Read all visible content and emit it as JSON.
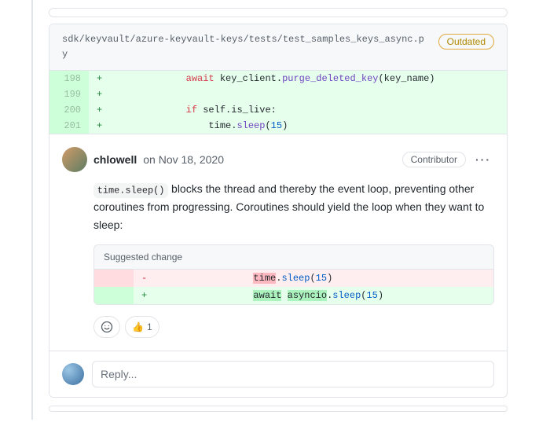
{
  "file": {
    "path": "sdk/keyvault/azure-keyvault-keys/tests/test_samples_keys_async.py",
    "outdated_label": "Outdated"
  },
  "diff": {
    "rows": [
      {
        "lineno": "198",
        "marker": "+",
        "code_html": "            <span class='tok-kw'>await</span> key_client.<span class='tok-call'>purge_deleted_key</span>(key_name)"
      },
      {
        "lineno": "199",
        "marker": "+",
        "code_html": ""
      },
      {
        "lineno": "200",
        "marker": "+",
        "code_html": "            <span class='tok-kw'>if</span> self.is_live:"
      },
      {
        "lineno": "201",
        "marker": "+",
        "code_html": "                time.<span class='tok-call'>sleep</span>(<span class='tok-num'>15</span>)"
      }
    ]
  },
  "comment": {
    "author": "chlowell",
    "timestamp_prefix": "on ",
    "timestamp": "Nov 18, 2020",
    "role_label": "Contributor",
    "inline_code": "time.sleep()",
    "body_rest": " blocks the thread and thereby the event loop, preventing other coroutines from progressing. Coroutines should yield the loop when they want to sleep:"
  },
  "suggestion": {
    "header": "Suggested change",
    "del_marker": "-",
    "add_marker": "+",
    "del_code_html": "                <span class='hl-red'>time</span>.<span class='tok-call2'>sleep</span>(<span class='tok-num'>15</span>)",
    "add_code_html": "                <span class='hl-green'>await</span> <span class='hl-green'>asyncio</span>.<span class='tok-call2'>sleep</span>(<span class='tok-num'>15</span>)"
  },
  "reactions": {
    "thumbs_up_emoji": "👍",
    "thumbs_up_count": "1"
  },
  "reply": {
    "placeholder": "Reply..."
  }
}
